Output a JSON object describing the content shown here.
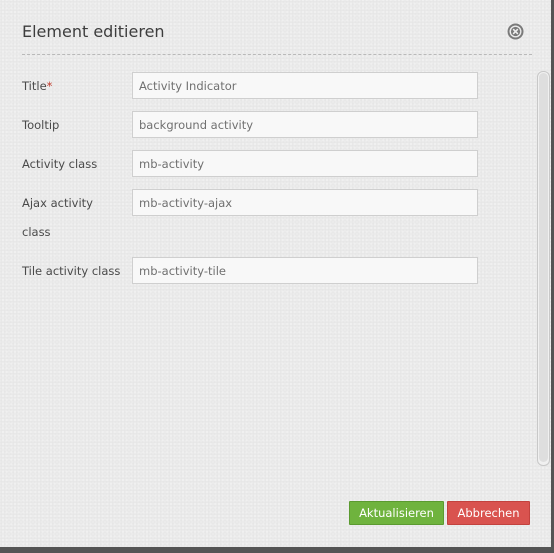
{
  "dialog": {
    "title": "Element editieren",
    "close_icon": "close-circle-icon"
  },
  "form": {
    "fields": [
      {
        "label": "Title",
        "required_mark": "*",
        "value": "Activity Indicator"
      },
      {
        "label": "Tooltip",
        "value": "background activity"
      },
      {
        "label": "Activity class",
        "value": "mb-activity"
      },
      {
        "label": "Ajax activity class",
        "value": "mb-activity-ajax"
      },
      {
        "label": "Tile activity class",
        "value": "mb-activity-tile"
      }
    ]
  },
  "buttons": {
    "update_label": "Aktualisieren",
    "cancel_label": "Abbrechen"
  },
  "colors": {
    "update": "#6fb33e",
    "cancel": "#d9534f",
    "required": "#c0392b"
  }
}
